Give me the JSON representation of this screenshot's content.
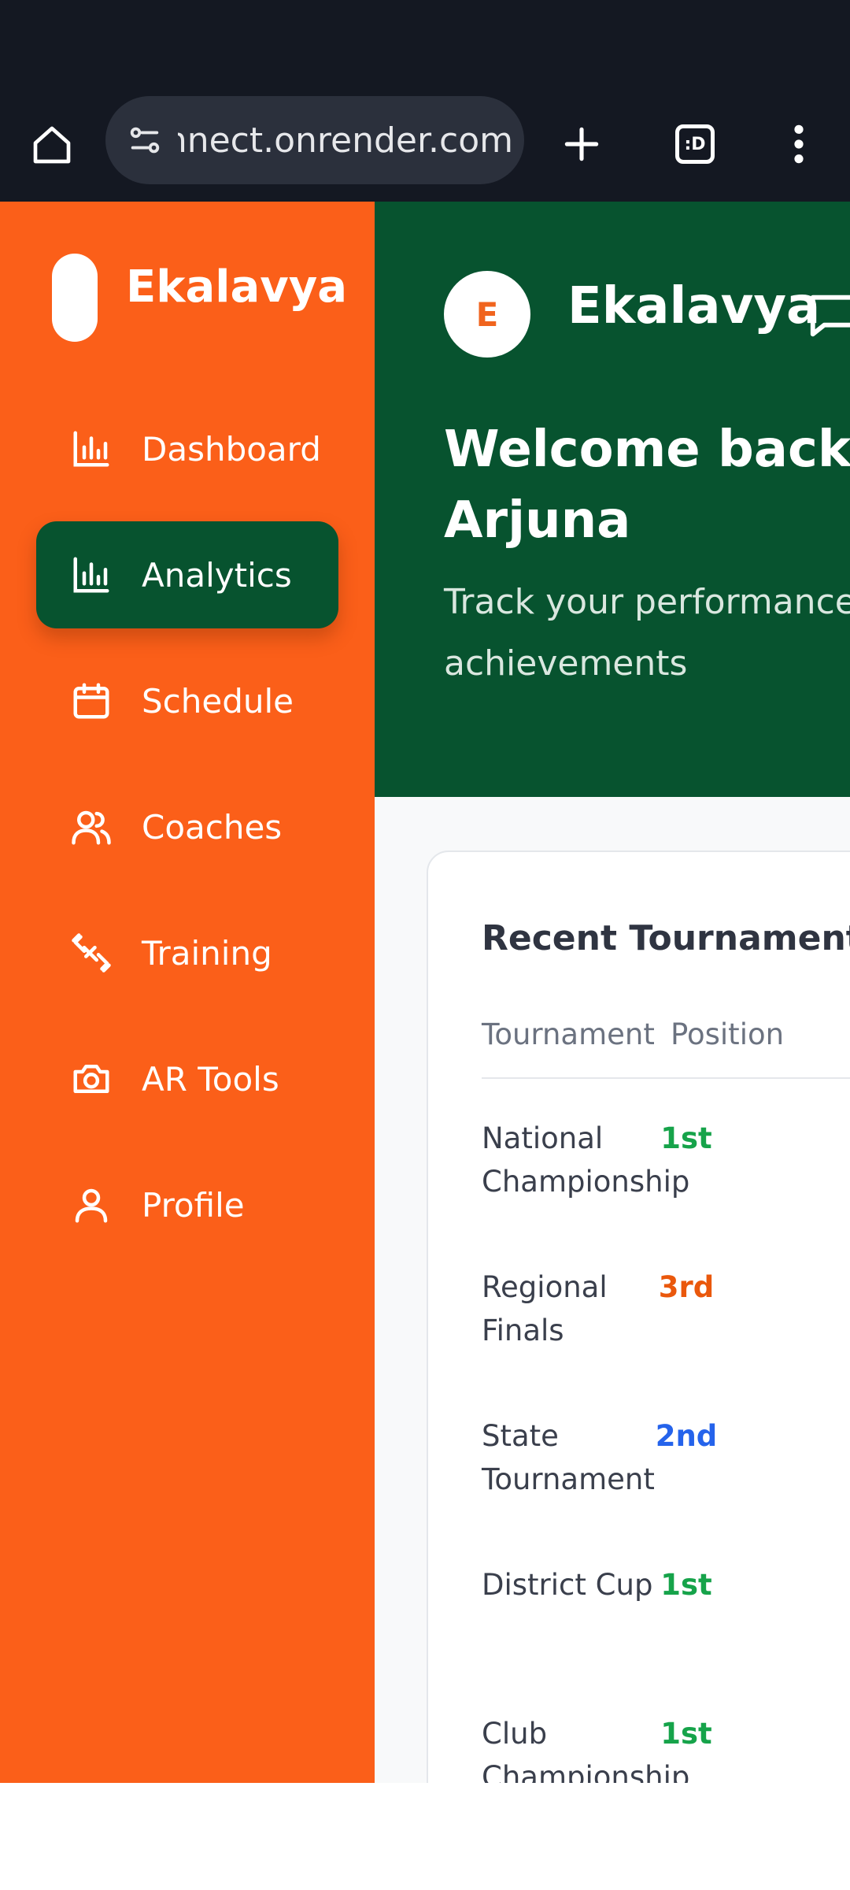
{
  "browser": {
    "url": "connect.onrender.com",
    "tab_count": ":D"
  },
  "sidebar": {
    "brand": "Ekalavya",
    "items": [
      {
        "label": "Dashboard",
        "icon": "bar-chart-icon",
        "active": false
      },
      {
        "label": "Analytics",
        "icon": "bar-chart-icon",
        "active": true
      },
      {
        "label": "Schedule",
        "icon": "calendar-icon",
        "active": false
      },
      {
        "label": "Coaches",
        "icon": "users-icon",
        "active": false
      },
      {
        "label": "Training",
        "icon": "dumbbell-icon",
        "active": false
      },
      {
        "label": "AR Tools",
        "icon": "camera-icon",
        "active": false
      },
      {
        "label": "Profile",
        "icon": "user-icon",
        "active": false
      }
    ]
  },
  "header": {
    "avatar_initial": "E",
    "brand": "Ekalavya",
    "welcome": "Welcome back, Arjuna",
    "subtitle": "Track your performance achievements"
  },
  "results": {
    "title": "Recent Tournament Res",
    "columns": [
      "Tournament",
      "Position"
    ],
    "rows": [
      {
        "tournament": "National Championship",
        "position": "1st",
        "color": "#16a34a"
      },
      {
        "tournament": "Regional Finals",
        "position": "3rd",
        "color": "#ea580c"
      },
      {
        "tournament": "State Tournament",
        "position": "2nd",
        "color": "#2563eb"
      },
      {
        "tournament": "District Cup",
        "position": "1st",
        "color": "#16a34a"
      },
      {
        "tournament": "Club Championship",
        "position": "1st",
        "color": "#16a34a"
      }
    ]
  },
  "colors": {
    "sidebar": "#fb5f19",
    "accent_green": "#07532f",
    "chrome": "#141822"
  }
}
